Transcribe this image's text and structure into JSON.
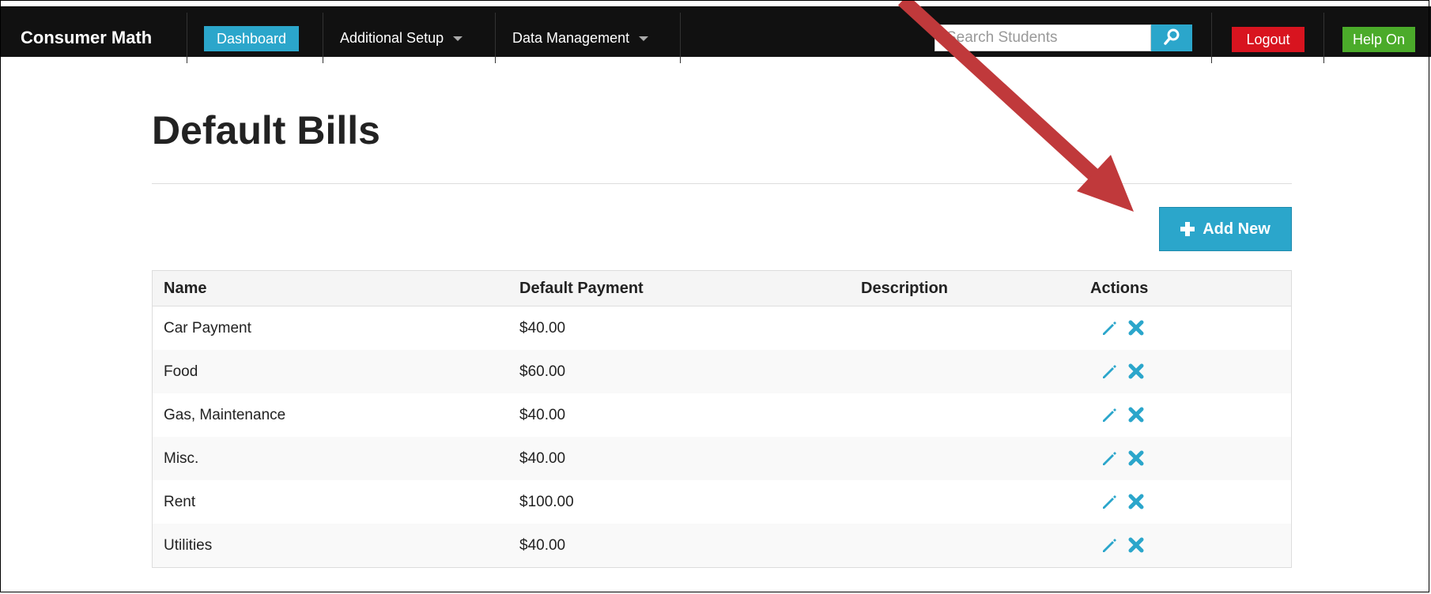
{
  "navbar": {
    "brand": "Consumer Math",
    "dashboard_label": "Dashboard",
    "additional_setup_label": "Additional Setup",
    "data_management_label": "Data Management",
    "search_placeholder": "Search Students",
    "logout_label": "Logout",
    "help_label": "Help On"
  },
  "page": {
    "title": "Default Bills",
    "add_new_label": "Add New"
  },
  "table": {
    "headers": {
      "name": "Name",
      "default_payment": "Default Payment",
      "description": "Description",
      "actions": "Actions"
    },
    "rows": [
      {
        "name": "Car Payment",
        "payment": "$40.00",
        "description": ""
      },
      {
        "name": "Food",
        "payment": "$60.00",
        "description": ""
      },
      {
        "name": "Gas, Maintenance",
        "payment": "$40.00",
        "description": ""
      },
      {
        "name": "Misc.",
        "payment": "$40.00",
        "description": ""
      },
      {
        "name": "Rent",
        "payment": "$100.00",
        "description": ""
      },
      {
        "name": "Utilities",
        "payment": "$40.00",
        "description": ""
      }
    ],
    "row_action_icons": [
      "pencil-icon",
      "close-icon"
    ]
  },
  "colors": {
    "navbar_bg": "#111111",
    "accent": "#2ba6cb",
    "logout": "#d8141f",
    "help": "#4bab2a",
    "annotation_arrow": "#c0393b"
  }
}
